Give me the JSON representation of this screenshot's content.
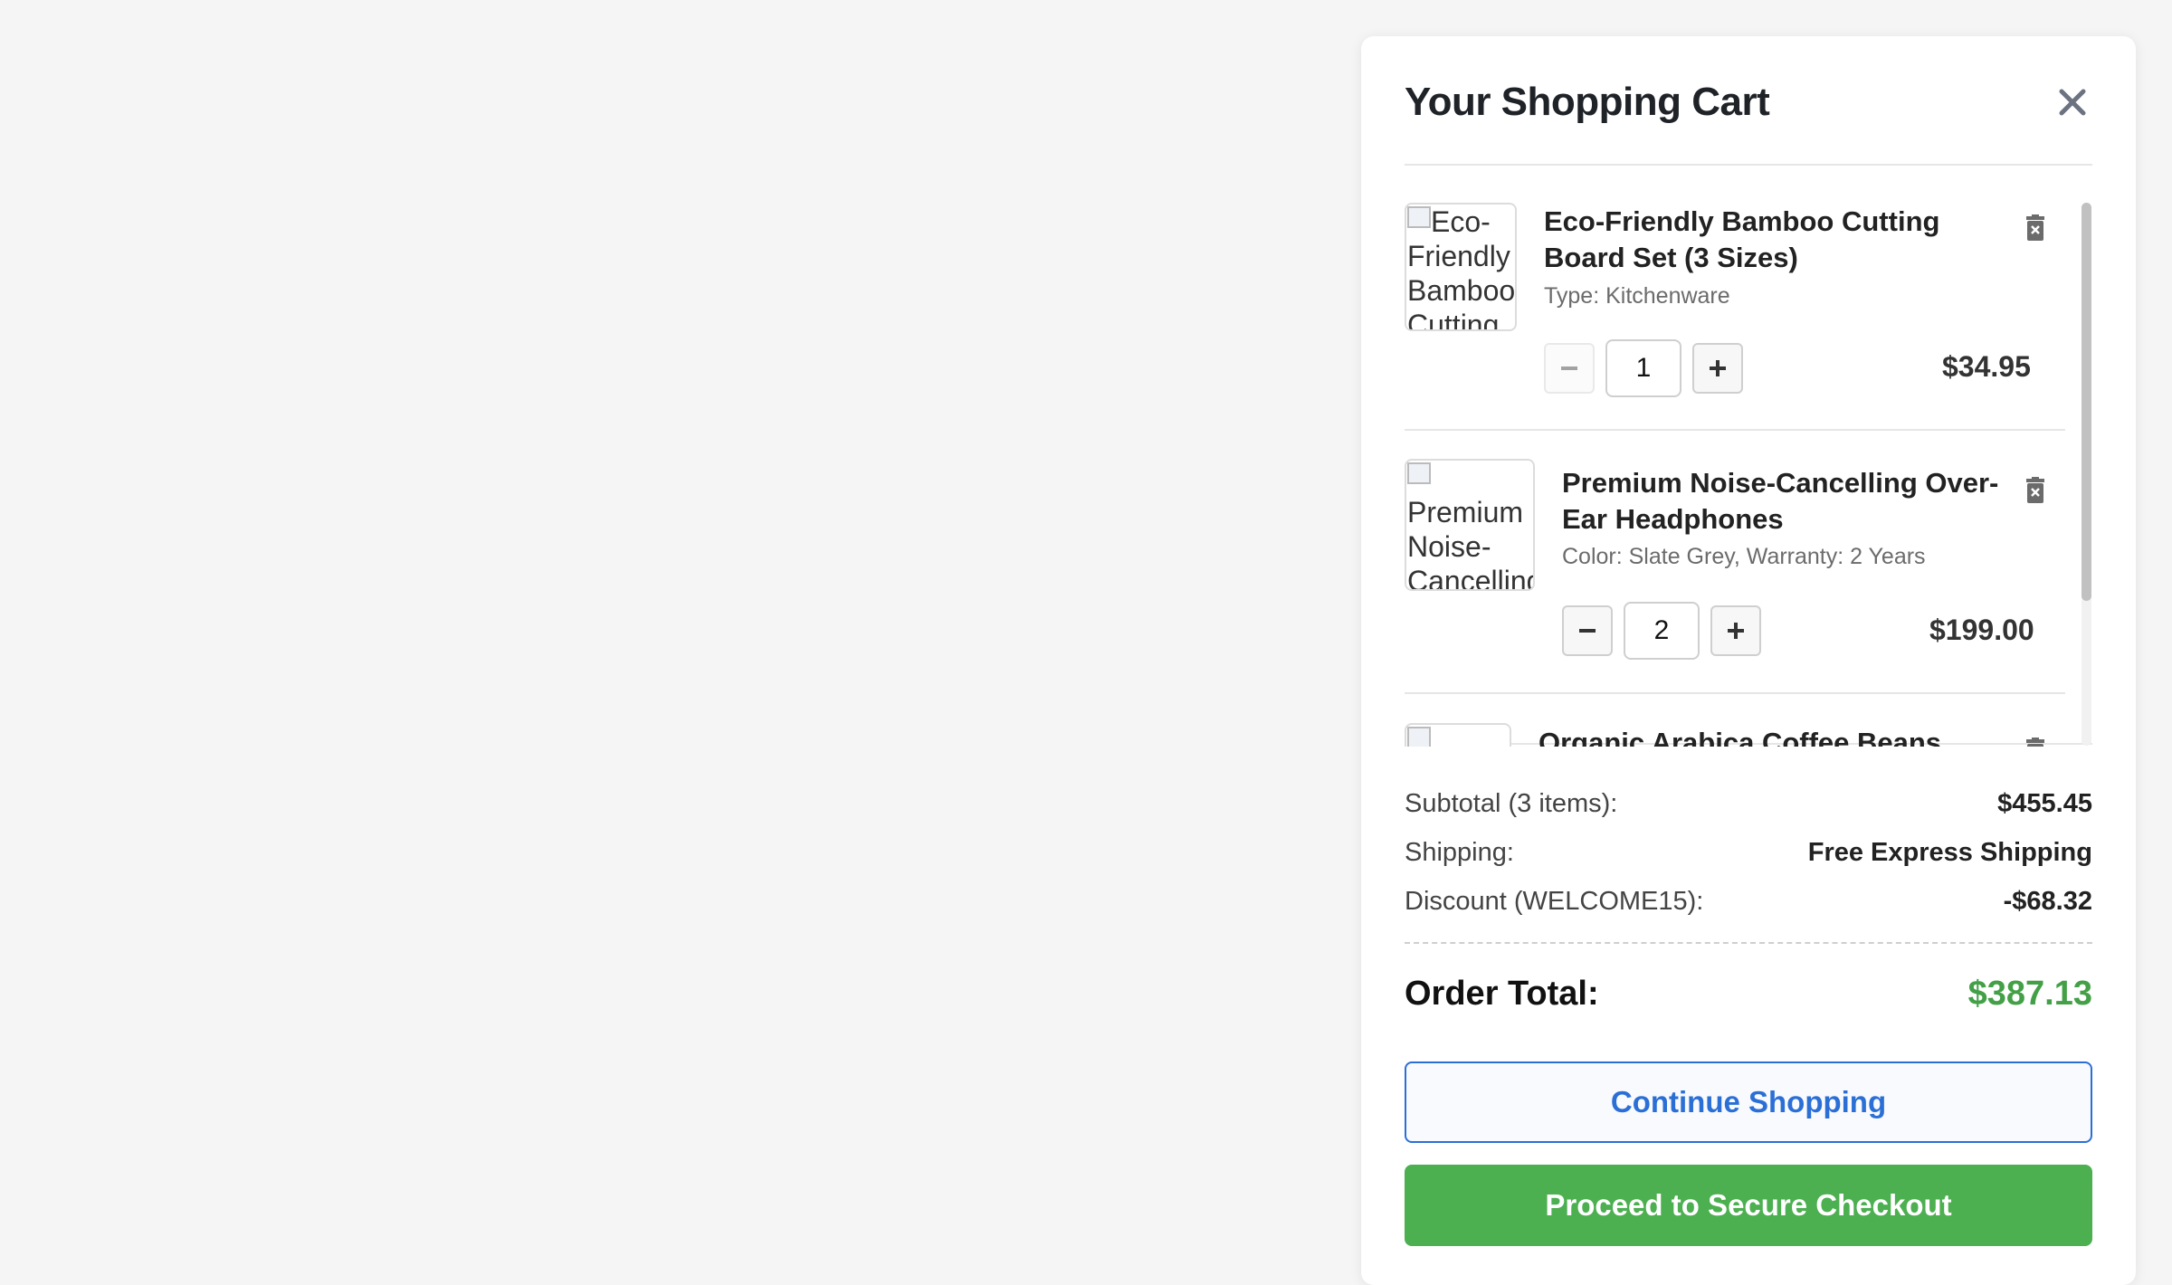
{
  "cart": {
    "title": "Your Shopping Cart",
    "close_icon": "close-icon",
    "items": [
      {
        "name_line1": "Eco-Friendly Bamboo Cutting",
        "name_line2": "Board Set (3 Sizes)",
        "meta": "Type: Kitchenware",
        "quantity": "1",
        "price": "$34.95",
        "image_alt_lines": [
          "Eco-",
          "Friendly",
          "Bamboo",
          "Cutting"
        ]
      },
      {
        "name_line1": "Premium Noise-Cancelling Over-",
        "name_line2": "Ear Headphones",
        "meta": "Color: Slate Grey, Warranty: 2 Years",
        "quantity": "2",
        "price": "$199.00",
        "image_alt_lines": [
          "Premium",
          "Noise-",
          "Cancelling"
        ]
      },
      {
        "name_line1": "Organic Arabica Coffee Beans"
      }
    ]
  },
  "summary": {
    "subtotal_label": "Subtotal (3 items):",
    "subtotal_value": "$455.45",
    "shipping_label": "Shipping:",
    "shipping_value": "Free Express Shipping",
    "discount_label": "Discount (WELCOME15):",
    "discount_value": "-$68.32",
    "total_label": "Order Total:",
    "total_value": "$387.13"
  },
  "buttons": {
    "continue_label": "Continue Shopping",
    "checkout_label": "Proceed to Secure Checkout"
  },
  "colors": {
    "accent_blue": "#2b6fd6",
    "total_green": "#43a047",
    "checkout_green": "#4caf50"
  }
}
